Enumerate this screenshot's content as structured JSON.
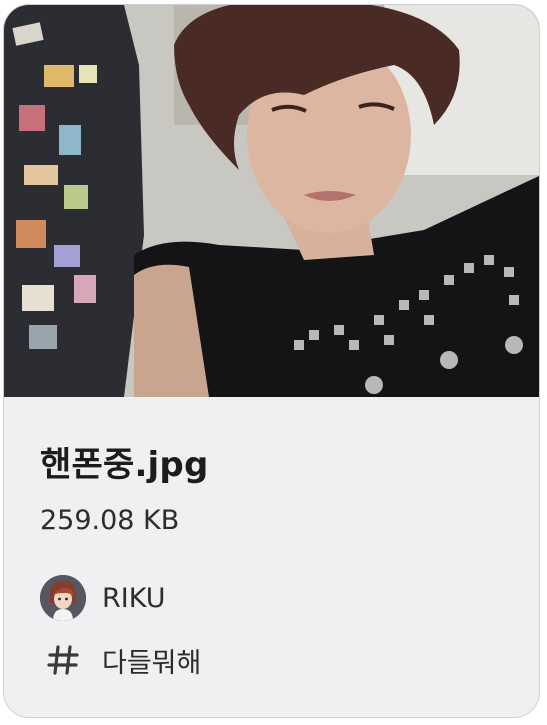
{
  "attachment": {
    "file_name": "핸폰중.jpg",
    "file_size": "259.08 KB",
    "uploader": {
      "name": "RIKU",
      "avatar_icon": "user-avatar-icon"
    },
    "channel": {
      "icon": "hash-icon",
      "name": "다들뭐해"
    },
    "preview_icon": "photo-preview"
  },
  "colors": {
    "card_background": "#f0f0f3",
    "card_border": "#cfcfd3",
    "title_text": "#1c1c1e",
    "body_text": "#2c2c2e"
  }
}
